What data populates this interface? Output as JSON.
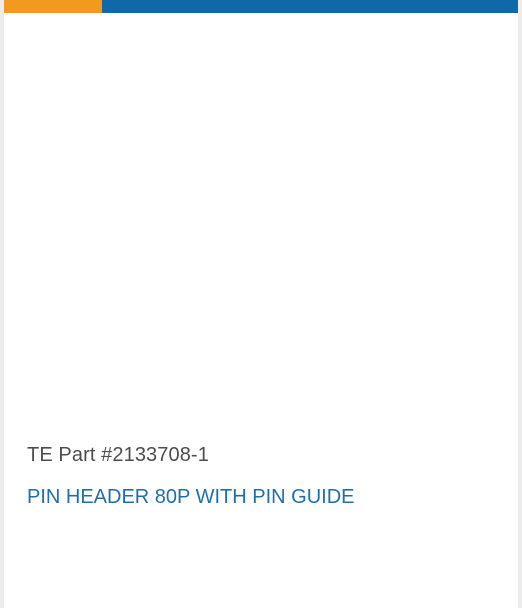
{
  "card": {
    "accent_colors": {
      "orange": "#f39a1e",
      "blue": "#0e68aa"
    },
    "part_number": "TE Part #2133708-1",
    "title": "PIN HEADER 80P WITH PIN GUIDE",
    "title_color": "#1f6fae",
    "part_number_color": "#4d4d4d"
  }
}
